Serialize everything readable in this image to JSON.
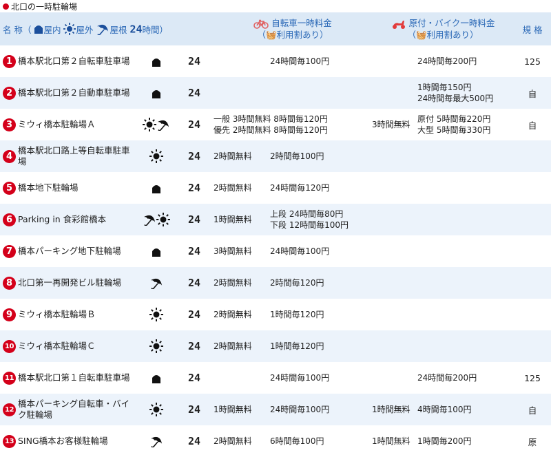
{
  "page_title": "北口の一時駐輪場",
  "header": {
    "name": "名 称（",
    "indoor": "屋内",
    "outdoor": "屋外",
    "roof": "屋根",
    "hours_num": "24",
    "hours_unit": "時間）",
    "bicycle_title": "自転車一時料金",
    "bicycle_sub": "利用割あり",
    "moto_title": "原付・バイク一時料金",
    "moto_sub": "利用割あり",
    "paren_open": "（",
    "paren_close": "）",
    "capacity": "規 格"
  },
  "rows": [
    {
      "num": "1",
      "name": "橋本駅北口第２自転車駐車場",
      "icons": [
        "indoor"
      ],
      "hours": "24",
      "bike_free": "",
      "bike_fee": [
        "24時間毎100円"
      ],
      "moto_free": "",
      "moto_fee": [
        "24時間毎200円"
      ],
      "cap": "125"
    },
    {
      "num": "2",
      "name": "橋本駅北口第２自動車駐車場",
      "icons": [
        "indoor"
      ],
      "hours": "24",
      "bike_free": "",
      "bike_fee": [],
      "moto_free": "",
      "moto_fee": [
        "1時間毎150円",
        "24時間毎最大500円"
      ],
      "cap": "自"
    },
    {
      "num": "3",
      "name": "ミウィ橋本駐輪場Ａ",
      "icons": [
        "sun",
        "umbrella"
      ],
      "hours": "24",
      "bike_free": "一般 3時間無料 8時間毎120円\n優先 2時間無料 8時間毎120円",
      "bike_fee": [],
      "moto_free": "3時間無料",
      "moto_fee": [
        "原付 5時間毎220円",
        "大型 5時間毎330円"
      ],
      "cap": "自"
    },
    {
      "num": "4",
      "name": "橋本駅北口路上等自転車駐車場",
      "icons": [
        "sun"
      ],
      "hours": "24",
      "bike_free": "2時間無料",
      "bike_fee": [
        "2時間毎100円"
      ],
      "moto_free": "",
      "moto_fee": [],
      "cap": ""
    },
    {
      "num": "5",
      "name": "橋本地下駐輪場",
      "icons": [
        "indoor"
      ],
      "hours": "24",
      "bike_free": "2時間無料",
      "bike_fee": [
        "24時間毎120円"
      ],
      "moto_free": "",
      "moto_fee": [],
      "cap": ""
    },
    {
      "num": "6",
      "name": "Parking in 食彩館橋本",
      "icons": [
        "umbrella",
        "sun"
      ],
      "hours": "24",
      "bike_free": "1時間無料",
      "bike_fee": [
        "上段 24時間毎80円",
        "下段 12時間毎100円"
      ],
      "moto_free": "",
      "moto_fee": [],
      "cap": ""
    },
    {
      "num": "7",
      "name": "橋本パーキング地下駐輪場",
      "icons": [
        "indoor"
      ],
      "hours": "24",
      "bike_free": "3時間無料",
      "bike_fee": [
        "24時間毎100円"
      ],
      "moto_free": "",
      "moto_fee": [],
      "cap": ""
    },
    {
      "num": "8",
      "name": "北口第一再開発ビル駐輪場",
      "icons": [
        "umbrella"
      ],
      "hours": "24",
      "bike_free": "2時間無料",
      "bike_fee": [
        "2時間毎120円"
      ],
      "moto_free": "",
      "moto_fee": [],
      "cap": ""
    },
    {
      "num": "9",
      "name": "ミウィ橋本駐輪場Ｂ",
      "icons": [
        "sun"
      ],
      "hours": "24",
      "bike_free": "2時間無料",
      "bike_fee": [
        "1時間毎120円"
      ],
      "moto_free": "",
      "moto_fee": [],
      "cap": ""
    },
    {
      "num": "10",
      "name": "ミウィ橋本駐輪場Ｃ",
      "icons": [
        "sun"
      ],
      "hours": "24",
      "bike_free": "2時間無料",
      "bike_fee": [
        "1時間毎120円"
      ],
      "moto_free": "",
      "moto_fee": [],
      "cap": ""
    },
    {
      "num": "11",
      "name": "橋本駅北口第１自転車駐車場",
      "icons": [
        "indoor"
      ],
      "hours": "24",
      "bike_free": "",
      "bike_fee": [
        "24時間毎100円"
      ],
      "moto_free": "",
      "moto_fee": [
        "24時間毎200円"
      ],
      "cap": "125"
    },
    {
      "num": "12",
      "name": "橋本パーキング自転車・バイク駐輪場",
      "icons": [
        "sun"
      ],
      "hours": "24",
      "bike_free": "1時間無料",
      "bike_fee": [
        "24時間毎100円"
      ],
      "moto_free": "1時間無料",
      "moto_fee": [
        "4時間毎100円"
      ],
      "cap": "自"
    },
    {
      "num": "13",
      "name": "SING橋本お客様駐輪場",
      "icons": [
        "umbrella"
      ],
      "hours": "24",
      "bike_free": "2時間無料",
      "bike_fee": [
        "6時間毎100円"
      ],
      "moto_free": "1時間無料",
      "moto_fee": [
        "1時間毎200円"
      ],
      "cap": "原"
    }
  ],
  "colors": {
    "accent_red": "#d4001a",
    "header_bg": "#dce9f6",
    "header_text": "#2a68b6",
    "row_alt": "#ecf3fb"
  }
}
